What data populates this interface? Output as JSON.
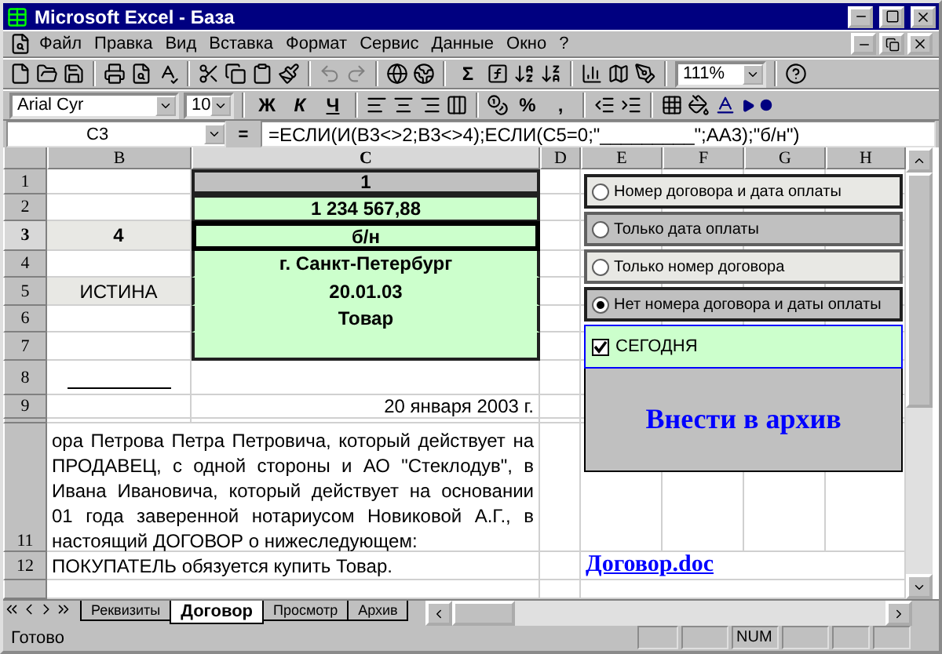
{
  "window": {
    "title": "Microsoft Excel - База"
  },
  "menu": [
    {
      "label": "Файл"
    },
    {
      "label": "Правка"
    },
    {
      "label": "Вид"
    },
    {
      "label": "Вставка"
    },
    {
      "label": "Формат"
    },
    {
      "label": "Сервис"
    },
    {
      "label": "Данные"
    },
    {
      "label": "Окно"
    },
    {
      "label": "?"
    }
  ],
  "standard_toolbar": {
    "sum_label": "Σ",
    "zoom": "111%"
  },
  "formatting_toolbar": {
    "font": "Arial Cyr",
    "size": "10",
    "bold_label": "Ж",
    "italic_label": "К",
    "underline_label": "Ч",
    "percent_label": "%",
    "comma_label": ","
  },
  "formula_bar": {
    "name_box": "C3",
    "equals": "=",
    "formula": "=ЕСЛИ(И(B3<>2;B3<>4);ЕСЛИ(C5=0;\"_________\";AA3);\"б/н\")"
  },
  "columns": [
    {
      "label": "B",
      "selected": false
    },
    {
      "label": "C",
      "selected": true
    },
    {
      "label": "D",
      "selected": false
    },
    {
      "label": "E",
      "selected": false
    },
    {
      "label": "F",
      "selected": false
    },
    {
      "label": "G",
      "selected": false
    },
    {
      "label": "H",
      "selected": false
    }
  ],
  "rows": [
    {
      "header": "1",
      "selected": false,
      "b": "",
      "c": "1",
      "kind": "title"
    },
    {
      "header": "2",
      "selected": false,
      "b": "",
      "c": "1 234 567,88",
      "kind": "green"
    },
    {
      "header": "3",
      "selected": true,
      "b": "4",
      "c": "б/н",
      "kind": "active"
    },
    {
      "header": "4",
      "selected": false,
      "b": "",
      "c": "г. Санкт-Петербург",
      "kind": "block"
    },
    {
      "header": "5",
      "selected": false,
      "b": "ИСТИНА",
      "c": "20.01.03",
      "kind": "block"
    },
    {
      "header": "6",
      "selected": false,
      "b": "",
      "c": "Товар",
      "kind": "block"
    },
    {
      "header": "7",
      "selected": false,
      "b": "",
      "c": "",
      "kind": "block"
    },
    {
      "header": "8",
      "selected": false,
      "b": "",
      "c": "",
      "kind": "line"
    },
    {
      "header": "9",
      "selected": false,
      "b": "",
      "c": "20 января 2003 г.",
      "kind": "date"
    },
    {
      "header": "",
      "selected": false,
      "b": "",
      "c": "",
      "kind": "thin"
    }
  ],
  "paragraph": {
    "header": "11",
    "lines": [
      "ора Петрова Петра Петровича, который действует на",
      "ПРОДАВЕЦ, с одной стороны и АО \"Стеклодув\", в",
      "Ивана Ивановича, который действует на основании",
      "01 года заверенной нотариусом Новиковой А.Г., в",
      "настоящий ДОГОВОР о нижеследующем:"
    ]
  },
  "row_12": {
    "header": "12",
    "text": "ПОКУПАТЕЛЬ обязуется купить Товар.",
    "link": "Договор.doc"
  },
  "options": [
    {
      "label": "Номер договора и дата оплаты",
      "selected": false
    },
    {
      "label": "Только дата оплаты",
      "selected": false
    },
    {
      "label": "Только номер договора",
      "selected": false
    },
    {
      "label": "Нет номера договора и даты оплаты",
      "selected": true
    }
  ],
  "checkbox": {
    "label": "СЕГОДНЯ",
    "checked": true
  },
  "archive_button": {
    "label": "Внести в архив"
  },
  "sheet_tabs": [
    {
      "label": "Реквизиты",
      "selected": false
    },
    {
      "label": "Договор",
      "selected": true
    },
    {
      "label": "Просмотр",
      "selected": false
    },
    {
      "label": "Архив",
      "selected": false
    }
  ],
  "status_bar": {
    "text": "Готово",
    "num": "NUM"
  }
}
